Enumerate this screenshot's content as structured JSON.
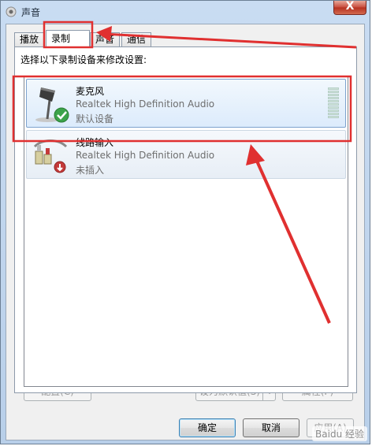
{
  "window": {
    "title": "声音",
    "close_label": "X"
  },
  "tabs": [
    {
      "label": "播放",
      "active": false
    },
    {
      "label": "录制",
      "active": true
    },
    {
      "label": "声音",
      "active": false
    },
    {
      "label": "通信",
      "active": false
    }
  ],
  "panel": {
    "instruction": "选择以下录制设备来修改设置:"
  },
  "devices": [
    {
      "name": "麦克风",
      "driver": "Realtek High Definition Audio",
      "status": "默认设备",
      "selected": true
    },
    {
      "name": "线路输入",
      "driver": "Realtek High Definition Audio",
      "status": "未插入",
      "selected": false
    }
  ],
  "buttons": {
    "configure": "配置(C)",
    "set_default": "设为默认值(S)",
    "properties": "属性(P)",
    "ok": "确定",
    "cancel": "取消",
    "apply": "应用(A)"
  },
  "watermark": "Baidu 经验",
  "colors": {
    "annotation": "#e03030",
    "selection_border": "#7da2ce",
    "close_button": "#c7493a"
  },
  "icons": {
    "window": "speaker-icon",
    "microphone": "microphone-icon",
    "line_in": "audio-jack-icon",
    "default_badge": "check-icon",
    "unplugged_badge": "down-arrow-icon"
  }
}
